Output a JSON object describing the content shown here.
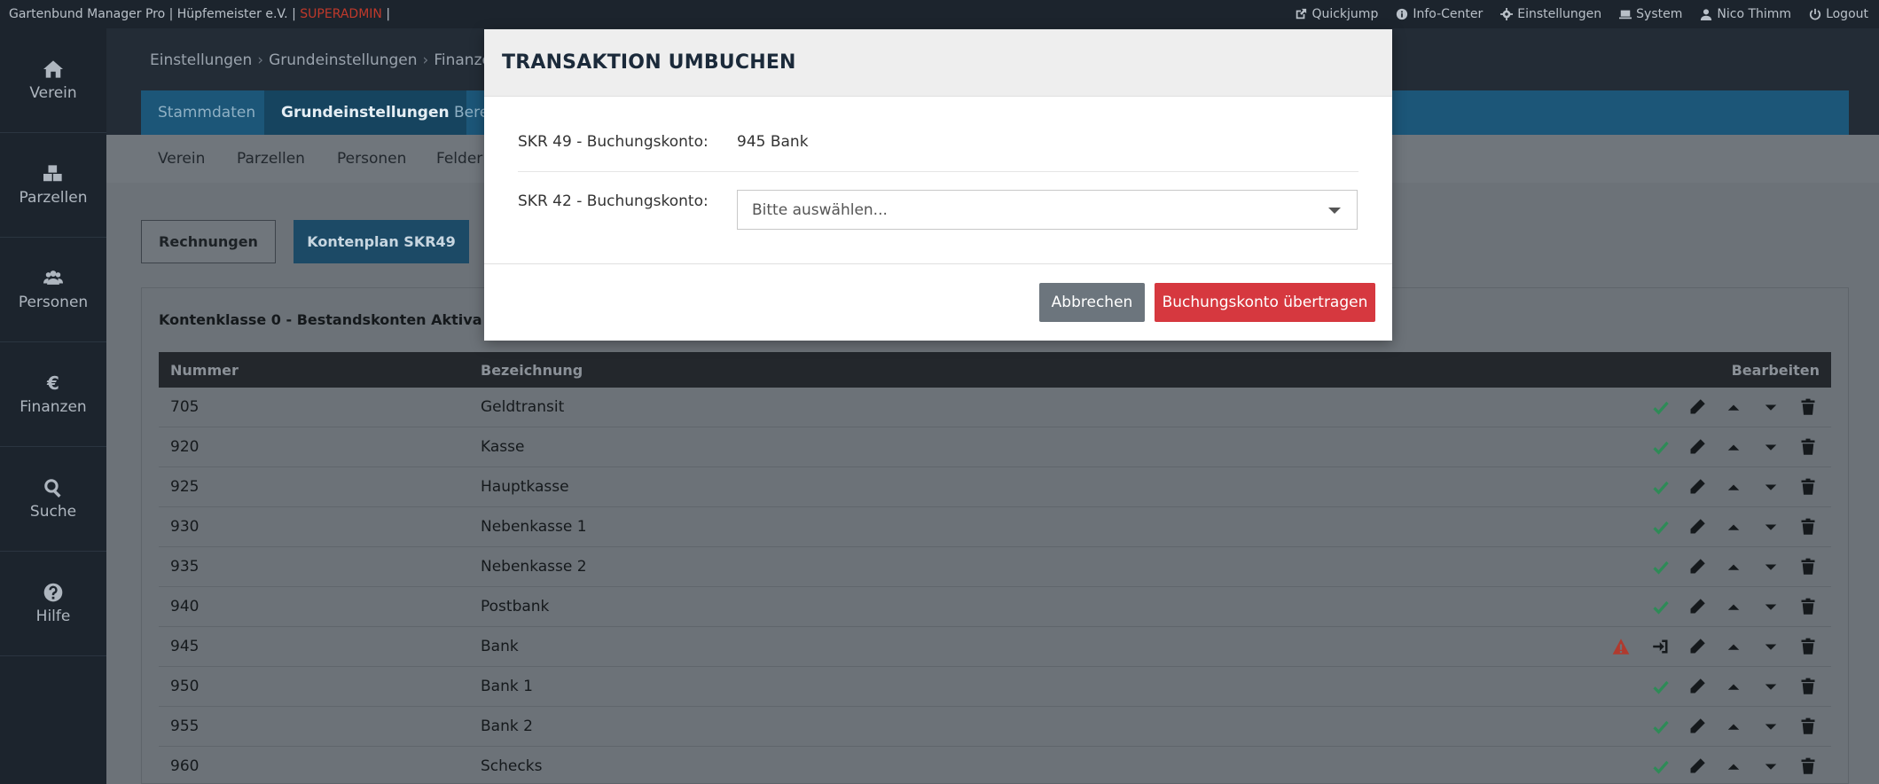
{
  "topbar": {
    "app_title": "Gartenbund Manager Pro | Hüpfemeister e.V. |",
    "role": "SUPERADMIN",
    "role_suffix": "|",
    "menu": [
      {
        "label": "Quickjump",
        "icon": "external-link-icon"
      },
      {
        "label": "Info-Center",
        "icon": "info-icon"
      },
      {
        "label": "Einstellungen",
        "icon": "gear-icon"
      },
      {
        "label": "System",
        "icon": "laptop-icon"
      },
      {
        "label": "Nico Thimm",
        "icon": "user-icon"
      },
      {
        "label": "Logout",
        "icon": "power-icon"
      }
    ]
  },
  "sidebar": {
    "items": [
      {
        "label": "Verein",
        "icon": "home-icon"
      },
      {
        "label": "Parzellen",
        "icon": "cubes-icon"
      },
      {
        "label": "Personen",
        "icon": "users-icon"
      },
      {
        "label": "Finanzen",
        "icon": "euro-icon",
        "glyph": "€"
      },
      {
        "label": "Suche",
        "icon": "search-icon"
      },
      {
        "label": "Hilfe",
        "icon": "question-icon"
      }
    ]
  },
  "breadcrumb": [
    "Einstellungen",
    "Grundeinstellungen",
    "Finanzen"
  ],
  "tabs": [
    "Stammdaten",
    "Grundeinstellungen",
    "Bere"
  ],
  "subnav": [
    "Verein",
    "Parzellen",
    "Personen",
    "Felder"
  ],
  "buttons": {
    "rechnungen": "Rechnungen",
    "kontenplan": "Kontenplan SKR49"
  },
  "panel": {
    "title": "Kontenklasse 0 - Bestandskonten Aktiva"
  },
  "table": {
    "headers": {
      "nummer": "Nummer",
      "bezeichnung": "Bezeichnung",
      "bearbeiten": "Bearbeiten"
    },
    "rows": [
      {
        "nummer": "705",
        "bezeichnung": "Geldtransit",
        "status": "ok"
      },
      {
        "nummer": "920",
        "bezeichnung": "Kasse",
        "status": "ok"
      },
      {
        "nummer": "925",
        "bezeichnung": "Hauptkasse",
        "status": "ok"
      },
      {
        "nummer": "930",
        "bezeichnung": "Nebenkasse 1",
        "status": "ok"
      },
      {
        "nummer": "935",
        "bezeichnung": "Nebenkasse 2",
        "status": "ok"
      },
      {
        "nummer": "940",
        "bezeichnung": "Postbank",
        "status": "ok"
      },
      {
        "nummer": "945",
        "bezeichnung": "Bank",
        "status": "warning"
      },
      {
        "nummer": "950",
        "bezeichnung": "Bank 1",
        "status": "ok"
      },
      {
        "nummer": "955",
        "bezeichnung": "Bank 2",
        "status": "ok"
      },
      {
        "nummer": "960",
        "bezeichnung": "Schecks",
        "status": "ok"
      }
    ]
  },
  "modal": {
    "title": "TRANSAKTION UMBUCHEN",
    "skr49_label": "SKR 49 - Buchungskonto:",
    "skr49_value": "945 Bank",
    "skr42_label": "SKR 42 - Buchungskonto:",
    "skr42_placeholder": "Bitte auswählen...",
    "cancel": "Abbrechen",
    "submit": "Buchungskonto übertragen"
  },
  "colors": {
    "ok": "#2e8b57",
    "warning": "#b03a2e",
    "danger": "#d6383f",
    "brand": "#1c5678"
  }
}
